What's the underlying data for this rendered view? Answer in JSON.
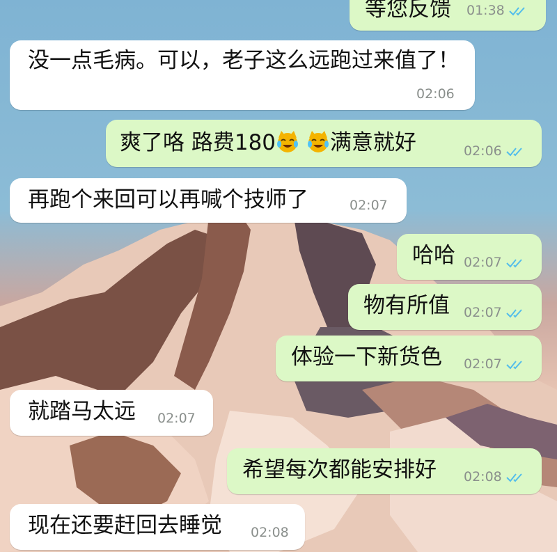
{
  "wallpaper": {
    "name": "snowy-mountain-landscape"
  },
  "colors": {
    "incoming_bubble": "#ffffff",
    "outgoing_bubble": "#dcf8c6",
    "check": "#53bdeb"
  },
  "messages": [
    {
      "dir": "out",
      "text": "等您反馈",
      "time": "01:38",
      "read": true
    },
    {
      "dir": "in",
      "text": "没一点毛病。可以，老子这么远跑过来值了！",
      "time": "02:06"
    },
    {
      "dir": "out",
      "text_before": "爽了咯  路费180",
      "emoji": "face-with-tears-of-joy-cat",
      "text_after": "满意就好",
      "time": "02:06",
      "read": true
    },
    {
      "dir": "in",
      "text": "再跑个来回可以再喊个技师了",
      "time": "02:07"
    },
    {
      "dir": "out",
      "text": "哈哈",
      "time": "02:07",
      "read": true
    },
    {
      "dir": "out",
      "text": "物有所值",
      "time": "02:07",
      "read": true
    },
    {
      "dir": "out",
      "text": "体验一下新货色",
      "time": "02:07",
      "read": true
    },
    {
      "dir": "in",
      "text": "就踏马太远",
      "time": "02:07"
    },
    {
      "dir": "out",
      "text": "希望每次都能安排好",
      "time": "02:08",
      "read": true
    },
    {
      "dir": "in",
      "text": "现在还要赶回去睡觉",
      "time": "02:08"
    }
  ]
}
